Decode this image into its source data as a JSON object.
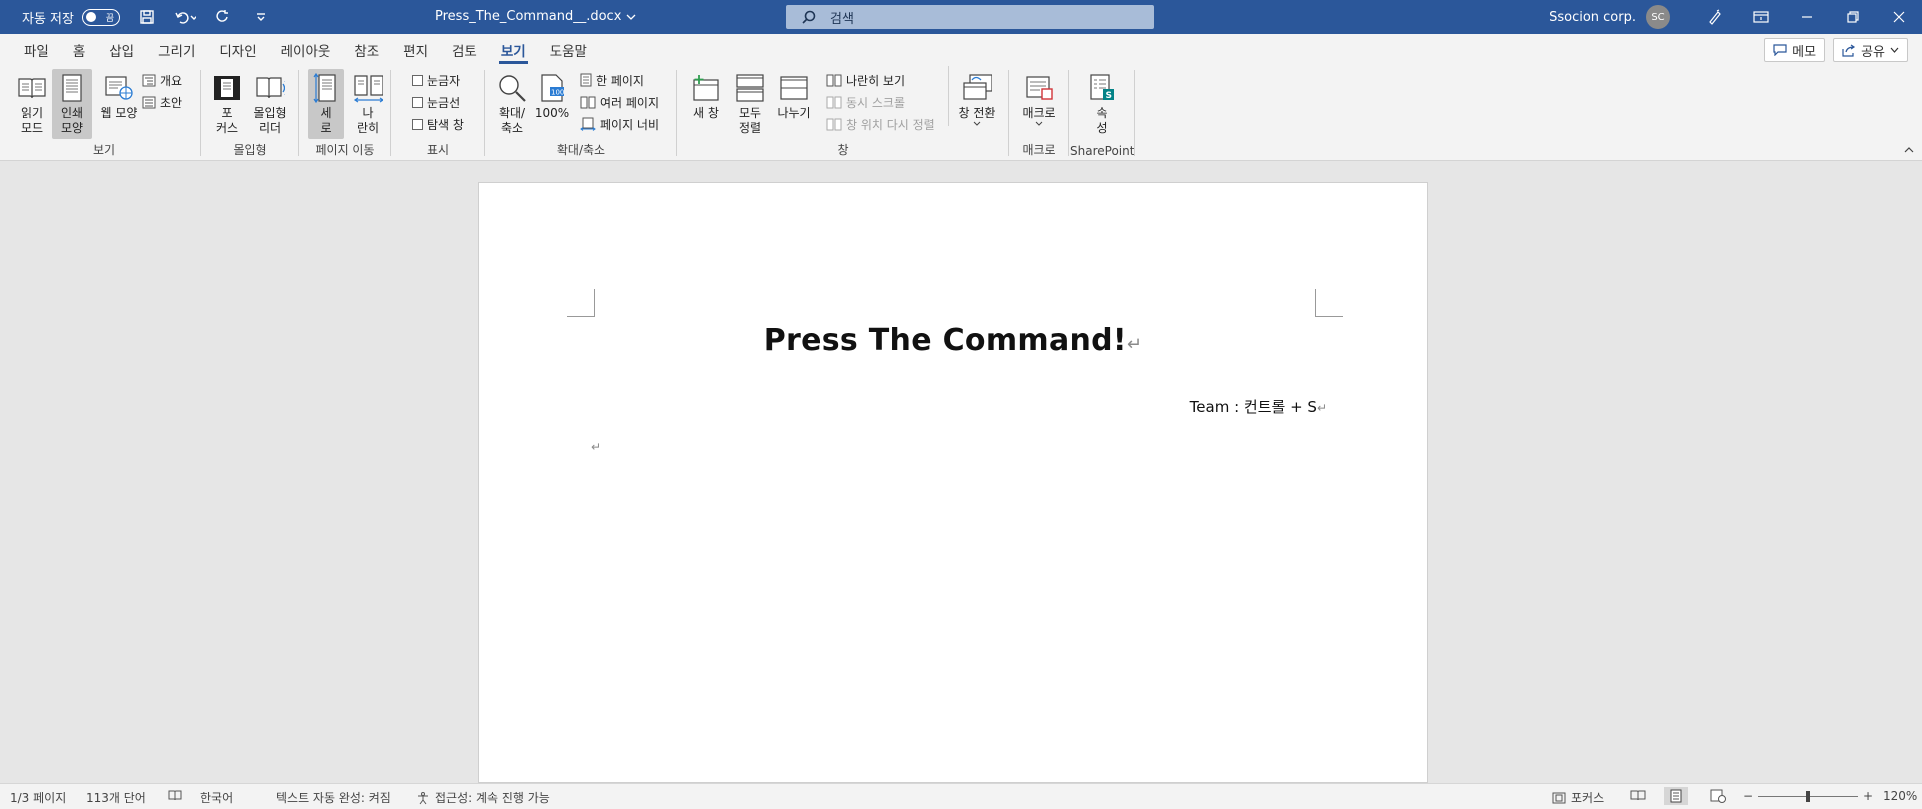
{
  "titlebar": {
    "autosave_label": "자동 저장",
    "autosave_state": "끔",
    "doc_title": "Press_The_Command__.docx",
    "search_placeholder": "검색",
    "user_name": "Ssocion corp.",
    "user_initials": "SC"
  },
  "tabs": [
    "파일",
    "홈",
    "삽입",
    "그리기",
    "디자인",
    "레이아웃",
    "참조",
    "편지",
    "검토",
    "보기",
    "도움말"
  ],
  "active_tab": "보기",
  "tabs_right": {
    "comments": "메모",
    "share": "공유"
  },
  "ribbon": {
    "view": {
      "read_mode": "읽기\n모드",
      "print_layout": "인쇄\n모양",
      "web_layout": "웹 모양",
      "outline": "개요",
      "draft": "초안",
      "label": "보기"
    },
    "immersive": {
      "focus": "포\n커스",
      "immersive_reader": "몰입형\n리더",
      "label": "몰입형"
    },
    "page_movement": {
      "vertical": "세\n로",
      "side_to_side": "나\n란히",
      "label": "페이지 이동"
    },
    "show": {
      "ruler": "눈금자",
      "gridlines": "눈금선",
      "nav_pane": "탐색 창",
      "label": "표시"
    },
    "zoom": {
      "zoom": "확대/\n축소",
      "hundred": "100%",
      "one_page": "한 페이지",
      "multiple_pages": "여러 페이지",
      "page_width": "페이지 너비",
      "label": "확대/축소"
    },
    "window": {
      "new_window": "새 창",
      "arrange_all": "모두\n정렬",
      "split": "나누기",
      "side_by_side": "나란히 보기",
      "sync_scroll": "동시 스크롤",
      "reset_position": "창 위치 다시 정렬",
      "switch_windows": "창 전환",
      "label": "창"
    },
    "macros": {
      "macros": "매크로",
      "label": "매크로"
    },
    "sharepoint": {
      "properties": "속\n성",
      "label": "SharePoint"
    }
  },
  "document": {
    "title": "Press The Command!",
    "team_line": "Team : 컨트롤 + S",
    "para_mark": "↵"
  },
  "statusbar": {
    "page": "1/3 페이지",
    "words": "113개 단어",
    "language": "한국어",
    "text_predictions": "텍스트 자동 완성: 켜짐",
    "accessibility": "접근성: 계속 진행 가능",
    "focus": "포커스",
    "zoom": "120%"
  },
  "colors": {
    "accent": "#2b579a",
    "canvas": "#e6e6e6"
  }
}
